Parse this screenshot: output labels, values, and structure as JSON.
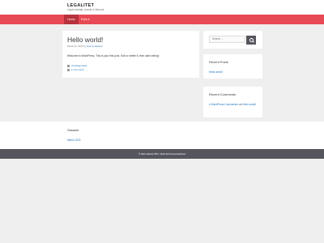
{
  "site": {
    "title": "LEGALITET",
    "description": "Legal hedelgt, pravila & hikevod"
  },
  "nav": {
    "items": [
      {
        "label": "Home"
      },
      {
        "label": "Poliu   ▾"
      }
    ]
  },
  "post": {
    "title": "Hello world!",
    "date": "March 26, 2021 by",
    "author": "Tommy Dewson",
    "content": "Welcome to WordPress. This is your first post. Edit or delete it, then start writing!",
    "category": "Uncategorized",
    "comments": "1 Comment"
  },
  "search": {
    "placeholder": "Search ..."
  },
  "recent_posts": {
    "title": "Recent Posts",
    "items": [
      "Hello world!"
    ]
  },
  "recent_comments": {
    "title": "Recent Comments",
    "commenter": "A WordPress Commenter",
    "connector": "on",
    "post": "Hello world!"
  },
  "archives": {
    "title": "Sasaste",
    "items": [
      "March 2021"
    ]
  },
  "footer": {
    "text": "© 2021 LEGALITET • Built with GeneratePress"
  },
  "colors": {
    "accent": "#e84a55",
    "nav_active": "#b8323d",
    "link": "#1e73be",
    "footer_bg": "#55555e"
  }
}
